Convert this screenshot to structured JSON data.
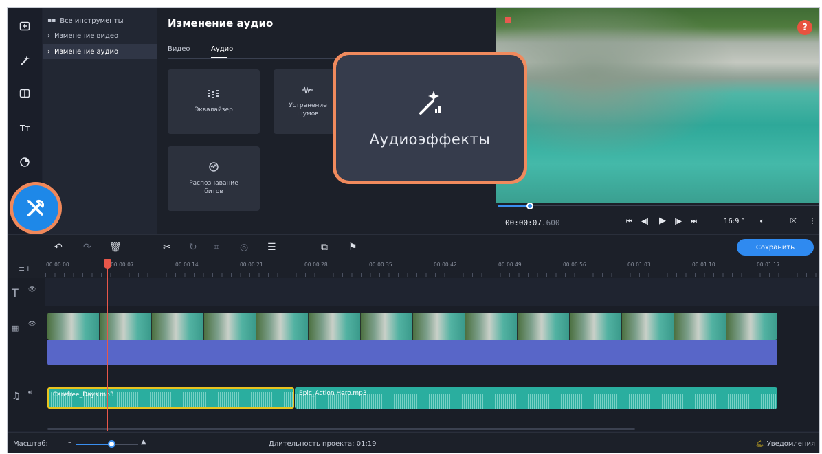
{
  "tree": {
    "all_tools": "Все инструменты",
    "video_edit": "Изменение видео",
    "audio_edit": "Изменение аудио"
  },
  "panel": {
    "title": "Изменение аудио",
    "tabs": [
      "Видео",
      "Аудио"
    ],
    "active_tab": "Аудио",
    "cards": [
      {
        "label": "Эквалайзер",
        "icon": "equalizer-icon"
      },
      {
        "label": "Устранение шумов",
        "icon": "noise-removal-icon"
      },
      {
        "label": "Распознавание битов",
        "icon": "beat-detection-icon"
      }
    ]
  },
  "callout": {
    "label": "Аудиоэффекты",
    "icon": "magic-wand-icon"
  },
  "preview": {
    "help": "?",
    "time_main": "00:00:07.",
    "time_ms": "600",
    "aspect": "16:9 ˅",
    "progress": 0.1
  },
  "toolbar": {
    "save_label": "Сохранить"
  },
  "ruler": {
    "ticks": [
      "00:00:00",
      "00:00:07",
      "00:00:14",
      "00:00:21",
      "00:00:28",
      "00:00:35",
      "00:00:42",
      "00:00:49",
      "00:00:56",
      "00:01:03",
      "00:01:10",
      "00:01:17"
    ]
  },
  "timeline": {
    "clip1_name": "Carefree_Days.mp3",
    "clip2_name": "Epic_Action Hero.mp3"
  },
  "status": {
    "zoom_label": "Масштаб:",
    "duration": "Длительность проекта: 01:19",
    "notifications": "Уведомления",
    "zoom_level": 0.58
  },
  "colors": {
    "accent": "#2f8af0",
    "highlight": "#f0885a",
    "video_track": "#5866c8",
    "music_clip": "#2aae9f",
    "selection": "#e8c31f"
  }
}
